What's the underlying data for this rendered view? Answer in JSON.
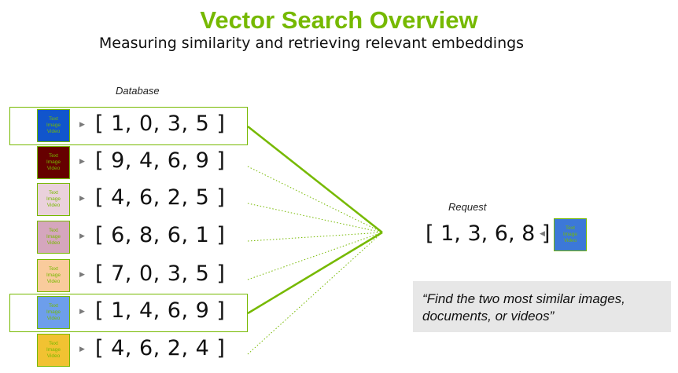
{
  "title": "Vector Search Overview",
  "subtitle": "Measuring similarity and retrieving relevant embeddings",
  "database_label": "Database",
  "request_label": "Request",
  "thumb_text": {
    "line1": "Text",
    "line2": "Image",
    "line3": "Video"
  },
  "database_items": [
    {
      "vector": "[ 1, 0, 3, 5 ]",
      "color": "#1155cc",
      "text_color": "#76b900",
      "highlighted": true
    },
    {
      "vector": "[ 9, 4, 6, 9 ]",
      "color": "#660000",
      "text_color": "#76b900",
      "highlighted": false
    },
    {
      "vector": "[ 4, 6, 2, 5 ]",
      "color": "#ead1dc",
      "text_color": "#76b900",
      "highlighted": false
    },
    {
      "vector": "[ 6, 8, 6, 1 ]",
      "color": "#d5a6bd",
      "text_color": "#76b900",
      "highlighted": false
    },
    {
      "vector": "[ 7, 0, 3, 5 ]",
      "color": "#f9cb9c",
      "text_color": "#76b900",
      "highlighted": false
    },
    {
      "vector": "[ 1, 4, 6, 9 ]",
      "color": "#6d9eeb",
      "text_color": "#76b900",
      "highlighted": true
    },
    {
      "vector": "[ 4, 6, 2, 4 ]",
      "color": "#f1c232",
      "text_color": "#76b900",
      "highlighted": false
    }
  ],
  "request": {
    "vector": "[ 1, 3, 6, 8 ]",
    "color": "#3c78d8",
    "text_color": "#76b900"
  },
  "query_text": "“Find the two most similar images, documents, or videos”",
  "colors": {
    "accent": "#76b900",
    "quote_bg": "#e7e7e7"
  }
}
